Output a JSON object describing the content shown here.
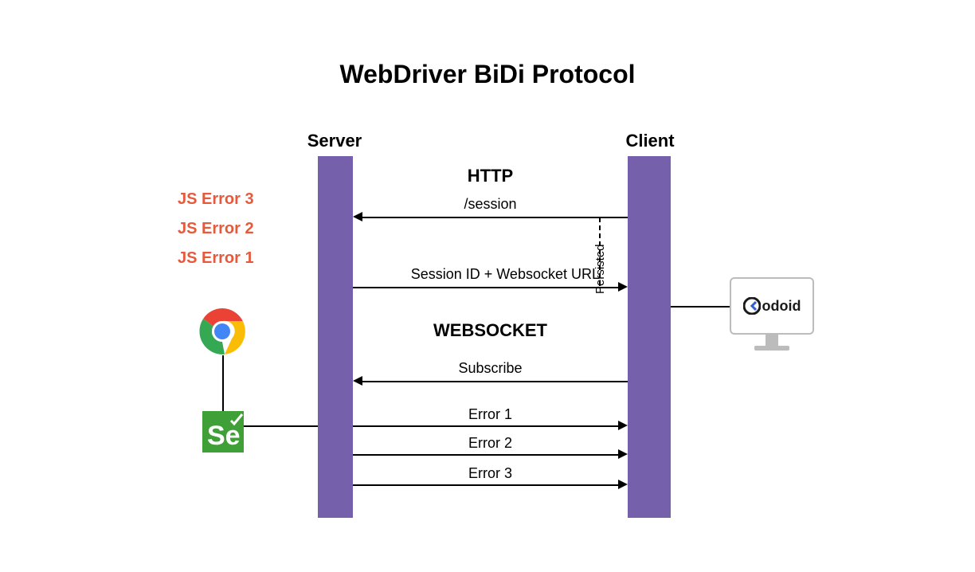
{
  "title": "WebDriver BiDi Protocol",
  "server_label": "Server",
  "client_label": "Client",
  "http_label": "HTTP",
  "websocket_label": "WEBSOCKET",
  "msg_session": "/session",
  "msg_response": "Session ID + Websocket URL",
  "msg_subscribe": "Subscribe",
  "msg_error1": "Error 1",
  "msg_error2": "Error 2",
  "msg_error3": "Error 3",
  "persisted_label": "Persisted",
  "js_error_1": "JS Error 3",
  "js_error_2": "JS Error 2",
  "js_error_3": "JS Error 1",
  "client_brand": "odoid",
  "colors": {
    "bar": "#7460ab",
    "error_text": "#e55a3c",
    "selenium": "#3fa038"
  }
}
